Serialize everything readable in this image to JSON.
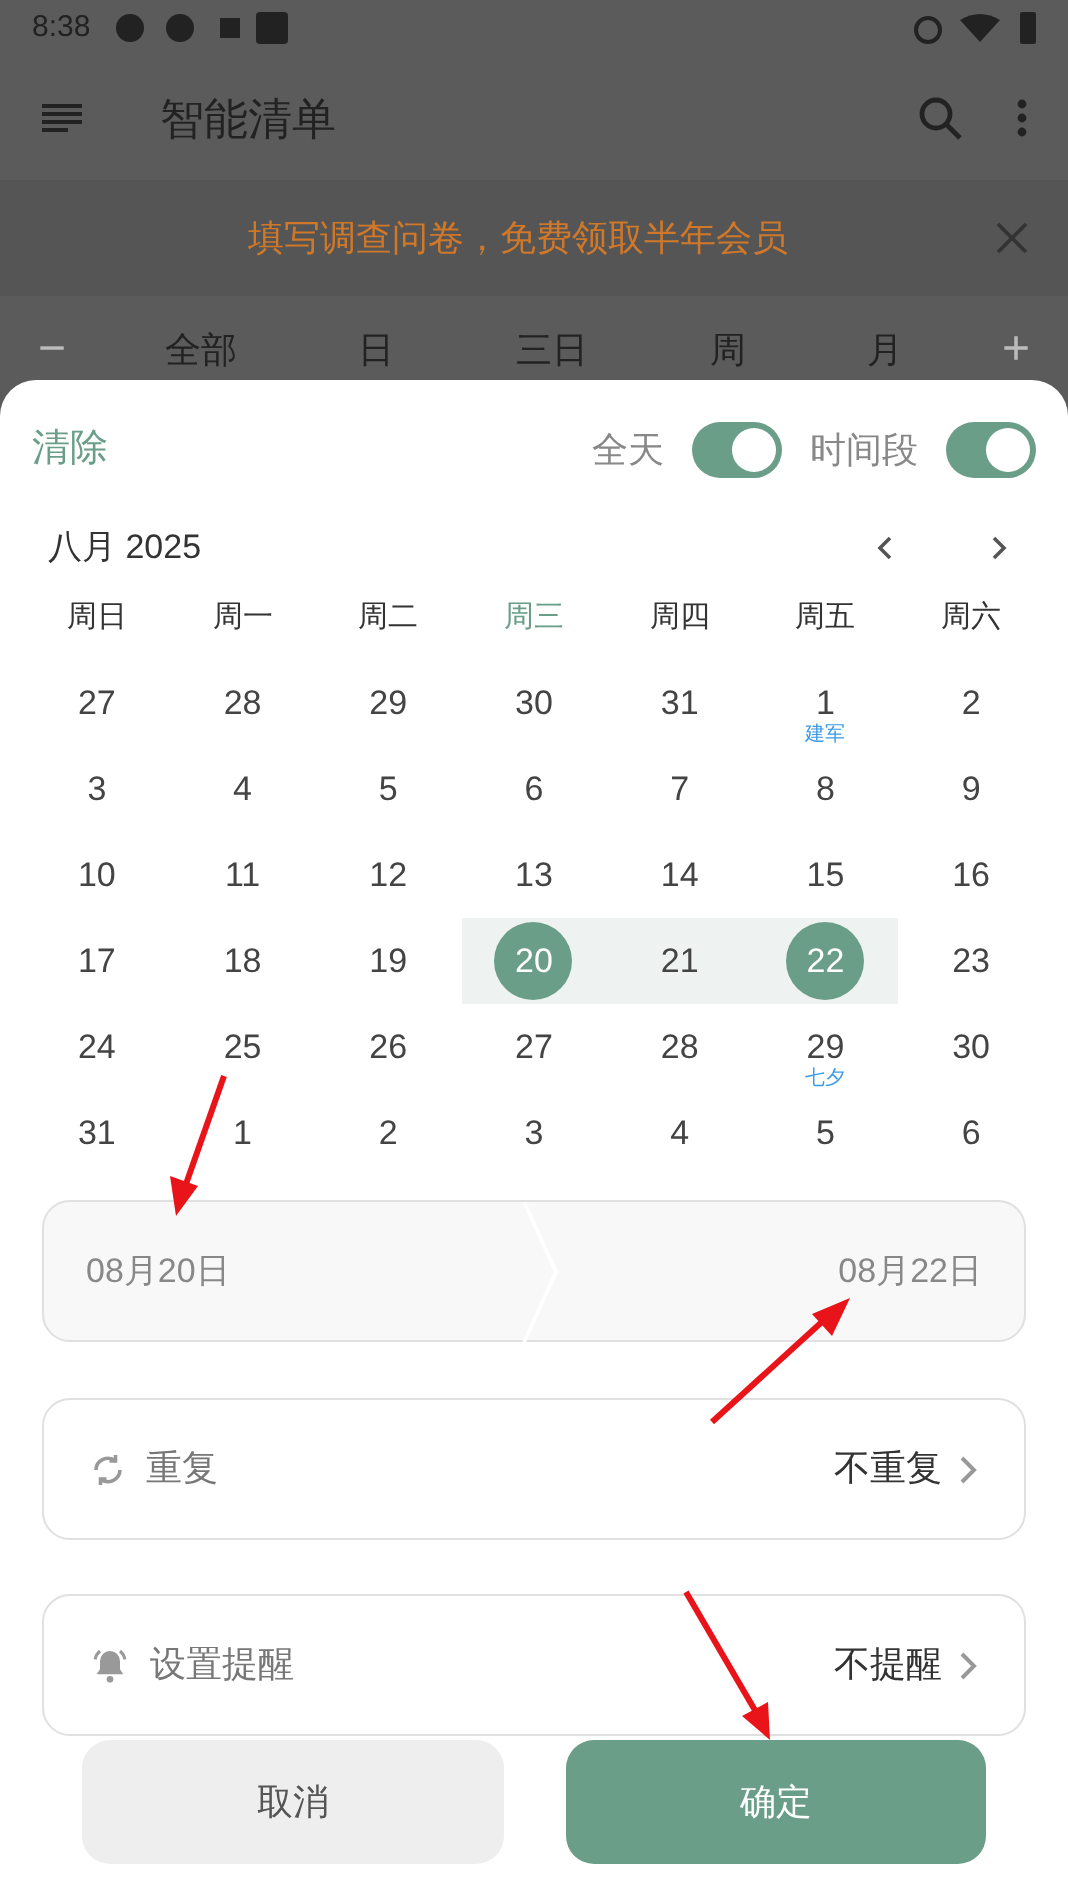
{
  "status_bar": {
    "time": "8:38"
  },
  "app_bar": {
    "title": "智能清单"
  },
  "banner": {
    "text": "填写调查问卷，免费领取半年会员"
  },
  "view_tabs": {
    "minus": "−",
    "plus": "+",
    "tabs": [
      {
        "label": "全部"
      },
      {
        "label": "日"
      },
      {
        "label": "三日"
      },
      {
        "label": "周"
      },
      {
        "label": "月"
      }
    ]
  },
  "sheet": {
    "clear": "清除",
    "toggles": [
      {
        "label": "全天",
        "on": true
      },
      {
        "label": "时间段",
        "on": true
      }
    ],
    "month": "八月 2025",
    "weekdays": [
      {
        "label": "周日",
        "today": false
      },
      {
        "label": "周一",
        "today": false
      },
      {
        "label": "周二",
        "today": false
      },
      {
        "label": "周三",
        "today": true
      },
      {
        "label": "周四",
        "today": false
      },
      {
        "label": "周五",
        "today": false
      },
      {
        "label": "周六",
        "today": false
      }
    ],
    "weeks": [
      [
        {
          "day": "27"
        },
        {
          "day": "28"
        },
        {
          "day": "29"
        },
        {
          "day": "30"
        },
        {
          "day": "31"
        },
        {
          "day": "1",
          "note": "建军"
        },
        {
          "day": "2"
        }
      ],
      [
        {
          "day": "3"
        },
        {
          "day": "4"
        },
        {
          "day": "5"
        },
        {
          "day": "6"
        },
        {
          "day": "7"
        },
        {
          "day": "8"
        },
        {
          "day": "9"
        }
      ],
      [
        {
          "day": "10"
        },
        {
          "day": "11"
        },
        {
          "day": "12"
        },
        {
          "day": "13"
        },
        {
          "day": "14"
        },
        {
          "day": "15"
        },
        {
          "day": "16"
        }
      ],
      [
        {
          "day": "17"
        },
        {
          "day": "18"
        },
        {
          "day": "19"
        },
        {
          "day": "20",
          "selected": true,
          "in_range": true
        },
        {
          "day": "21",
          "in_range": true
        },
        {
          "day": "22",
          "selected": true,
          "in_range": true
        },
        {
          "day": "23"
        }
      ],
      [
        {
          "day": "24"
        },
        {
          "day": "25"
        },
        {
          "day": "26"
        },
        {
          "day": "27"
        },
        {
          "day": "28"
        },
        {
          "day": "29",
          "note": "七夕"
        },
        {
          "day": "30"
        }
      ],
      [
        {
          "day": "31"
        },
        {
          "day": "1"
        },
        {
          "day": "2"
        },
        {
          "day": "3"
        },
        {
          "day": "4"
        },
        {
          "day": "5"
        },
        {
          "day": "6"
        }
      ]
    ],
    "range": {
      "start": "08月20日",
      "end": "08月22日"
    },
    "options": [
      {
        "kind": "repeat",
        "label": "重复",
        "value": "不重复"
      },
      {
        "kind": "reminder",
        "label": "设置提醒",
        "value": "不提醒"
      }
    ],
    "buttons": {
      "cancel": "取消",
      "confirm": "确定"
    }
  }
}
